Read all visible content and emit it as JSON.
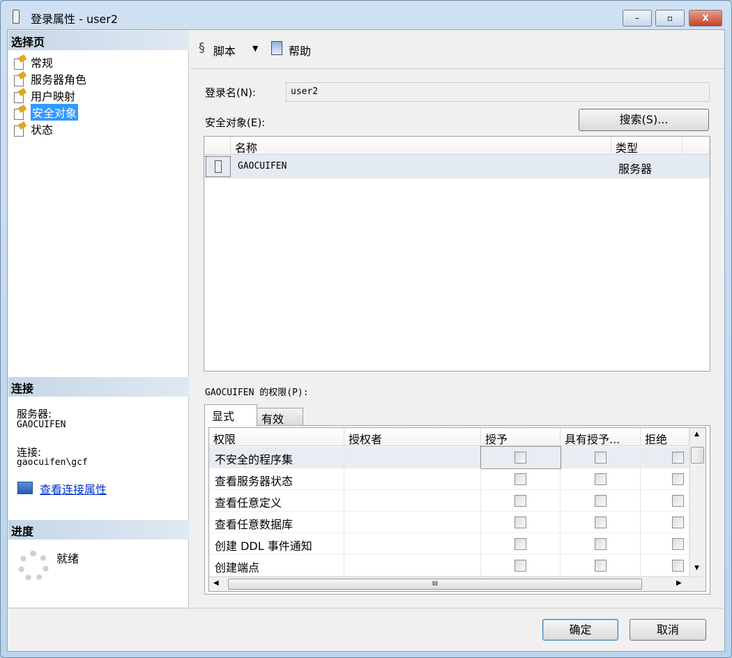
{
  "window": {
    "title": "登录属性 - user2",
    "minimize": "–",
    "maximize": "▫",
    "close": "X"
  },
  "left": {
    "select_page_header": "选择页",
    "nav": [
      {
        "label": "常规"
      },
      {
        "label": "服务器角色"
      },
      {
        "label": "用户映射"
      },
      {
        "label": "安全对象"
      },
      {
        "label": "状态"
      }
    ],
    "connection_header": "连接",
    "server_label": "服务器:",
    "server_value": "GAOCUIFEN",
    "connection_label": "连接:",
    "connection_value": "gaocuifen\\gcf",
    "view_conn_link": "查看连接属性",
    "progress_header": "进度",
    "progress_status": "就绪"
  },
  "toolbar": {
    "script_label": "脚本",
    "dropdown": "▼",
    "help_label": "帮助"
  },
  "form": {
    "login_name_label": "登录名(N):",
    "login_name_value": "user2",
    "securables_label": "安全对象(E):",
    "search_button": "搜索(S)..."
  },
  "securables": {
    "columns": [
      "名称",
      "类型"
    ],
    "rows": [
      {
        "name": "GAOCUIFEN",
        "type": "服务器"
      }
    ]
  },
  "permissions": {
    "label": "GAOCUIFEN 的权限(P):",
    "tabs": [
      "显式",
      "有效"
    ],
    "columns": [
      "权限",
      "授权者",
      "授予",
      "具有授予...",
      "拒绝"
    ],
    "rows": [
      {
        "permission": "不安全的程序集",
        "grantor": "",
        "grant": false,
        "with_grant": false,
        "deny": false
      },
      {
        "permission": "查看服务器状态",
        "grantor": "",
        "grant": false,
        "with_grant": false,
        "deny": false
      },
      {
        "permission": "查看任意定义",
        "grantor": "",
        "grant": false,
        "with_grant": false,
        "deny": false
      },
      {
        "permission": "查看任意数据库",
        "grantor": "",
        "grant": false,
        "with_grant": false,
        "deny": false
      },
      {
        "permission": "创建 DDL 事件通知",
        "grantor": "",
        "grant": false,
        "with_grant": false,
        "deny": false
      },
      {
        "permission": "创建端点",
        "grantor": "",
        "grant": false,
        "with_grant": false,
        "deny": false
      }
    ],
    "hscroll_grip": "III"
  },
  "footer": {
    "ok": "确定",
    "cancel": "取消"
  }
}
